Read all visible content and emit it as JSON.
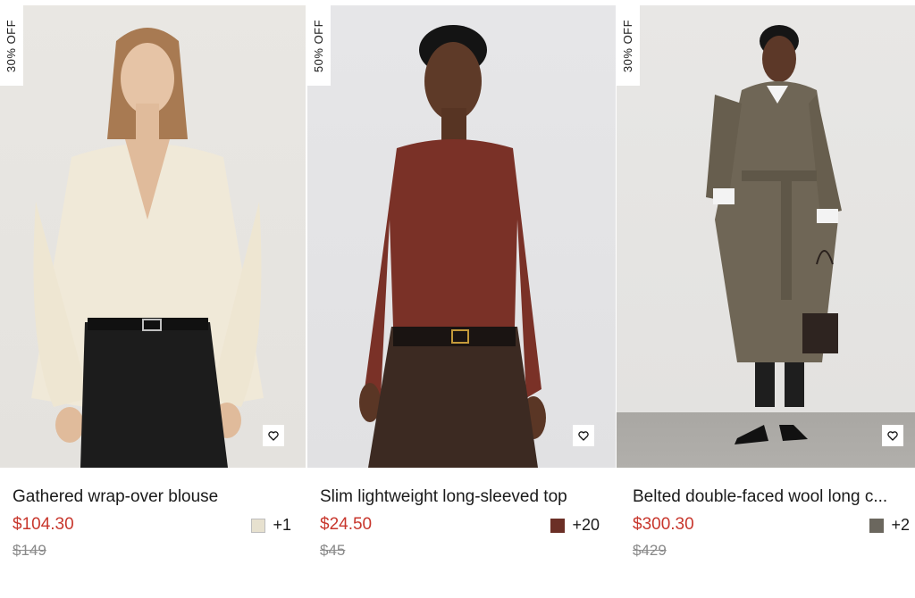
{
  "products": [
    {
      "discount_badge": "30% OFF",
      "title": "Gathered wrap-over blouse",
      "price": "$104.30",
      "original_price": "$149",
      "swatch_color": "#e7e1cf",
      "more_colors": "+1"
    },
    {
      "discount_badge": "50% OFF",
      "title": "Slim lightweight long-sleeved top",
      "price": "$24.50",
      "original_price": "$45",
      "swatch_color": "#6b2f26",
      "more_colors": "+20"
    },
    {
      "discount_badge": "30% OFF",
      "title": "Belted double-faced wool long c...",
      "price": "$300.30",
      "original_price": "$429",
      "swatch_color": "#6b675e",
      "more_colors": "+2"
    }
  ],
  "icons": {
    "wishlist": "heart-outline-icon"
  },
  "colors": {
    "sale_price": "#c8372d",
    "original_price": "#8a8a8a"
  }
}
